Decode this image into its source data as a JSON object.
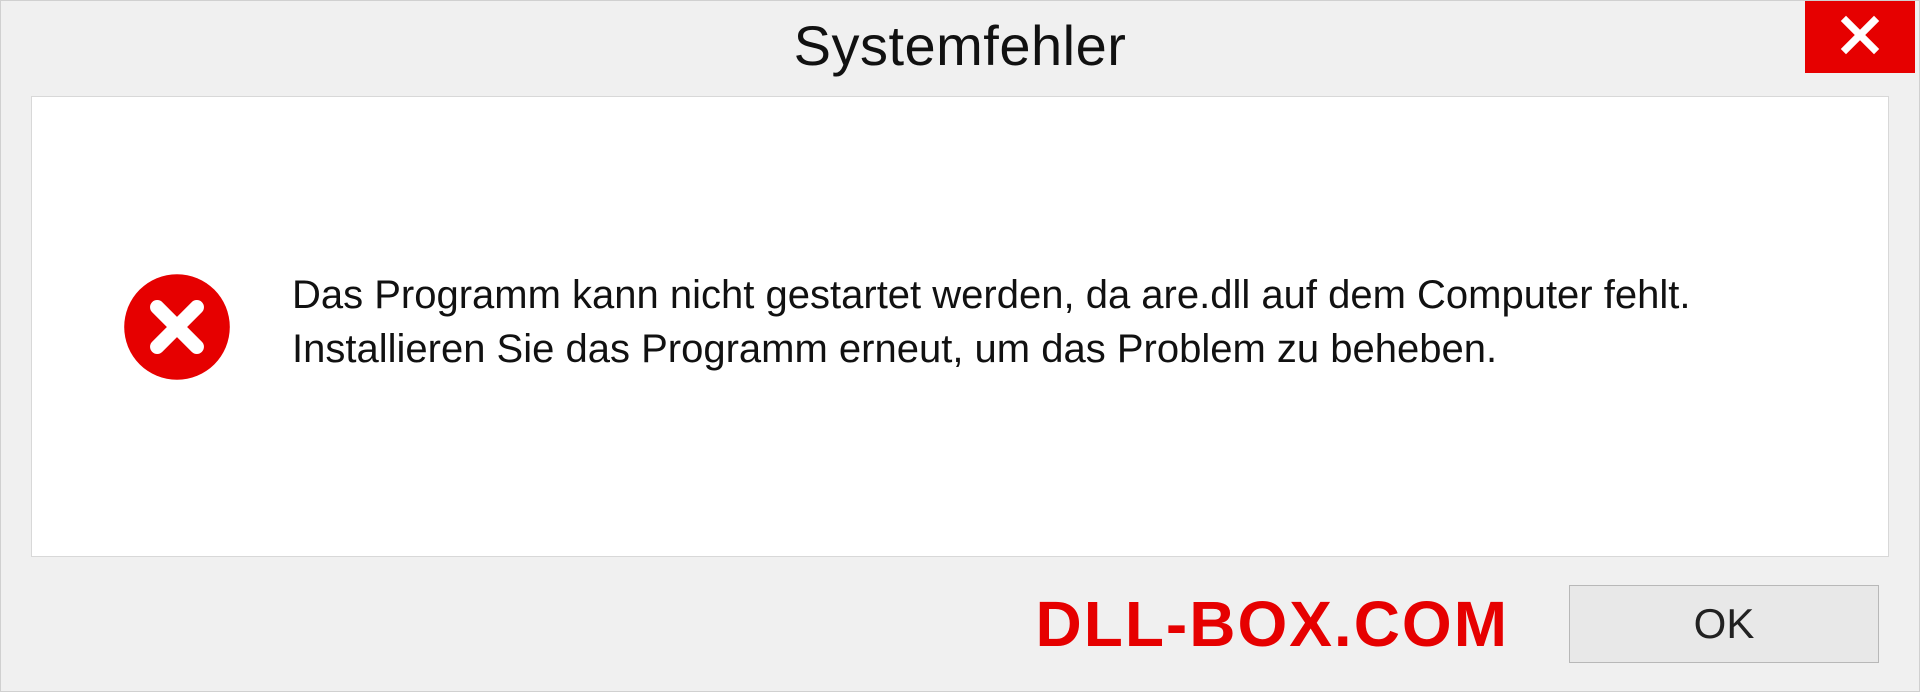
{
  "dialog": {
    "title": "Systemfehler",
    "message": "Das Programm kann nicht gestartet werden, da are.dll auf dem Computer fehlt. Installieren Sie das Programm erneut, um das Problem zu beheben.",
    "ok_label": "OK"
  },
  "brand": {
    "text": "DLL-BOX.COM"
  },
  "colors": {
    "accent_red": "#e60000",
    "background": "#f0f0f0",
    "content_bg": "#ffffff"
  }
}
